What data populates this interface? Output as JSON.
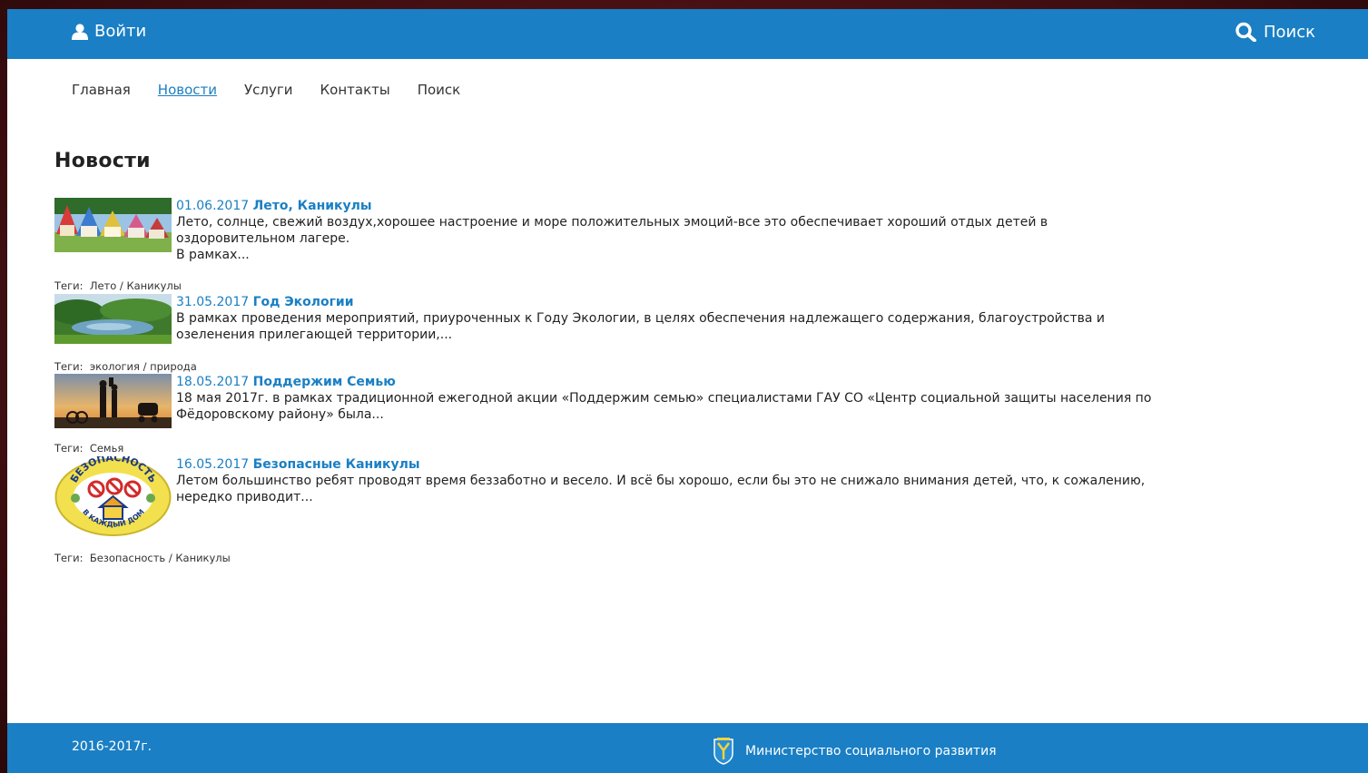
{
  "header": {
    "login_label": "Войти",
    "search_label": "Поиск"
  },
  "menu": [
    {
      "label": "Главная",
      "active": false
    },
    {
      "label": "Новости",
      "active": true
    },
    {
      "label": "Услуги",
      "active": false
    },
    {
      "label": "Контакты",
      "active": false
    },
    {
      "label": "Поиск",
      "active": false
    }
  ],
  "page_title": "Новости",
  "news": [
    {
      "date": "01.06.2017",
      "title": "Лето, Каникулы",
      "text": [
        "Лето, солнце, свежий воздух,хорошее настроение и море положительных эмоций-все это обеспечивает хороший отдых детей в",
        "оздоровительном лагере.",
        "В рамках..."
      ],
      "tags_label": "Теги:",
      "tags": "Лето / Каникулы"
    },
    {
      "date": "31.05.2017",
      "title": "Год Экологии",
      "text": [
        "В рамках проведения мероприятий, приуроченных к Году Экологии, в целях обеспечения надлежащего содержания, благоустройства и",
        "озеленения прилегающей территории,..."
      ],
      "tags_label": "Теги:",
      "tags": "экология / природа"
    },
    {
      "date": "18.05.2017",
      "title": "Поддержим Семью",
      "text": [
        "18 мая 2017г. в рамках традиционной ежегодной акции «Поддержим семью» специалистами ГАУ СО «Центр социальной защиты населения по",
        "Фёдоровскому району»  была..."
      ],
      "tags_label": "Теги:",
      "tags": "Семья"
    },
    {
      "date": "16.05.2017",
      "title": "Безопасные Каникулы",
      "text": [
        "Летом большинство ребят проводят время беззаботно и весело. И всё бы хорошо, если бы это не снижало внимания детей, что, к сожалению,",
        "нередко приводит..."
      ],
      "tags_label": "Теги:",
      "tags": "Безопасность / Каникулы",
      "logo_text": [
        "БЕЗОПАСНОСТЬ",
        "В КАЖДЫЙ ДОМ"
      ]
    }
  ],
  "footer": {
    "copyright": "2016-2017г.",
    "ministry": "Министерство социального развития"
  },
  "colors": {
    "brand_blue": "#1a7fc4",
    "background_maroon": "#4a1114"
  }
}
